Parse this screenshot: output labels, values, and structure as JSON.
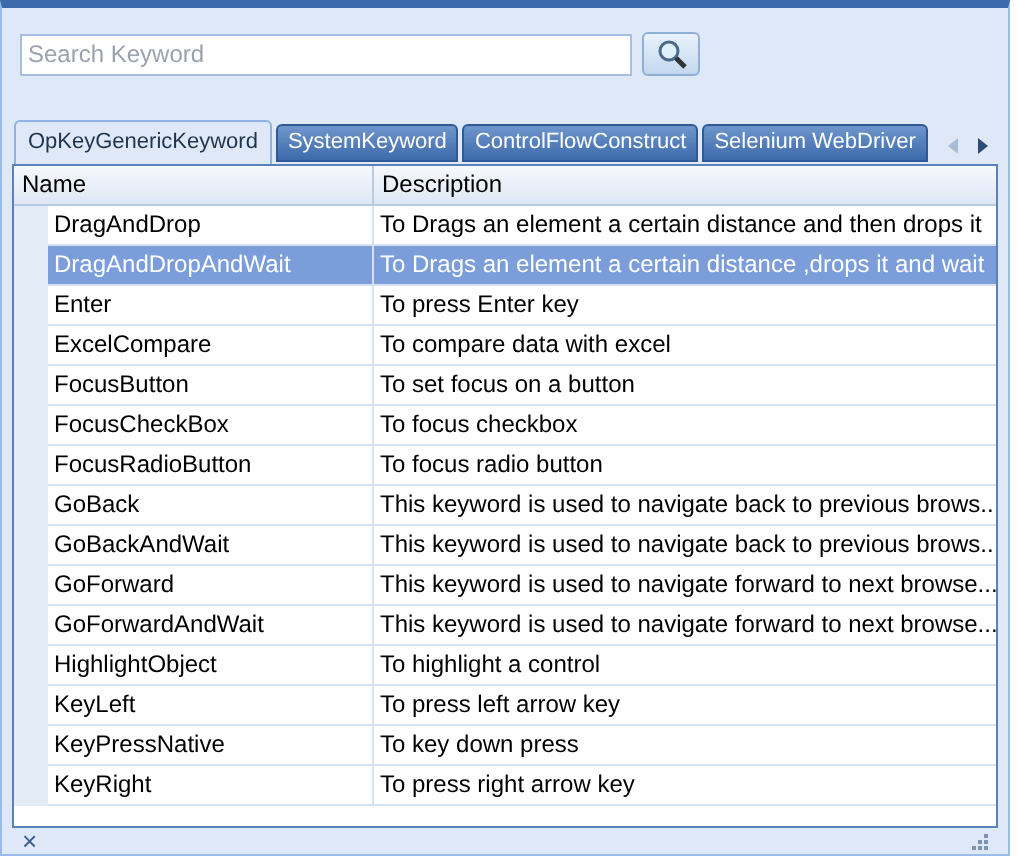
{
  "search": {
    "placeholder": "Search Keyword"
  },
  "tabs": [
    {
      "label": "OpKeyGenericKeyword",
      "selected": true
    },
    {
      "label": "SystemKeyword",
      "selected": false
    },
    {
      "label": "ControlFlowConstruct",
      "selected": false
    },
    {
      "label": "Selenium WebDriver",
      "selected": false
    }
  ],
  "table": {
    "columns": [
      "Name",
      "Description"
    ],
    "rows": [
      {
        "name": "DragAndDrop",
        "description": "To Drags an element a certain distance and then drops it",
        "selected": false
      },
      {
        "name": "DragAndDropAndWait",
        "description": "To Drags an element a certain distance ,drops it and wait",
        "selected": true
      },
      {
        "name": "Enter",
        "description": "To press Enter key",
        "selected": false
      },
      {
        "name": "ExcelCompare",
        "description": "To compare data with excel",
        "selected": false
      },
      {
        "name": "FocusButton",
        "description": "To set focus on a button",
        "selected": false
      },
      {
        "name": "FocusCheckBox",
        "description": "To focus checkbox",
        "selected": false
      },
      {
        "name": "FocusRadioButton",
        "description": "To focus radio button",
        "selected": false
      },
      {
        "name": "GoBack",
        "description": "This keyword is used to navigate back to previous brows...",
        "selected": false
      },
      {
        "name": "GoBackAndWait",
        "description": "This keyword is used to navigate back to previous brows...",
        "selected": false
      },
      {
        "name": "GoForward",
        "description": "This keyword is used to navigate forward to next browse...",
        "selected": false
      },
      {
        "name": "GoForwardAndWait",
        "description": "This keyword is used to navigate forward to next browse...",
        "selected": false
      },
      {
        "name": "HighlightObject",
        "description": "To highlight a control",
        "selected": false
      },
      {
        "name": "KeyLeft",
        "description": "To press left arrow key",
        "selected": false
      },
      {
        "name": "KeyPressNative",
        "description": "To key down press",
        "selected": false
      },
      {
        "name": "KeyRight",
        "description": "To press right arrow key",
        "selected": false
      }
    ]
  },
  "status_bar": {
    "close": "×"
  }
}
